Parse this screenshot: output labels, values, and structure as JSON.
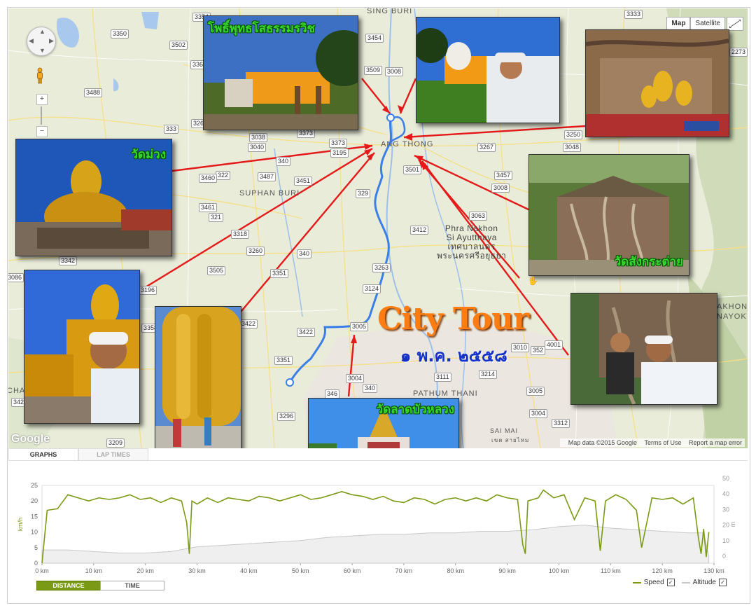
{
  "map": {
    "map_type_buttons": [
      {
        "label": "Map",
        "selected": true
      },
      {
        "label": "Satellite",
        "selected": false
      }
    ],
    "attribution": {
      "data": "Map data ©2015 Google",
      "terms": "Terms of Use",
      "report": "Report a map error"
    },
    "logo_text": "Google",
    "pan_icon": "pan-control-icon",
    "pegman_icon": "pegman-icon",
    "zoom_in": "+",
    "zoom_out": "−",
    "places": {
      "sing_buri": "SING BURI",
      "ang_thong": "ANG THONG",
      "suphan_buri": "SUPHAN BURI",
      "ayutthaya_1": "Phra Nakhon",
      "ayutthaya_2": "Si Ayutthaya",
      "ayutthaya_3": "เทศบาลนคร",
      "ayutthaya_4": "พระนครศรีอยุธยา",
      "pathum_thani": "PATHUM THANI",
      "sai_mai": "SAI MAI",
      "nakhon_nayok_1": "AKHON",
      "nakhon_nayok_2": "NAYOK",
      "cha": "CHA",
      "khet_sai_mai": "เขต สายไหม"
    },
    "road_numbers": [
      "3354",
      "3333",
      "3350",
      "3454",
      "3502",
      "3509",
      "3008",
      "2273",
      "3365",
      "3488",
      "3264",
      "3038",
      "3373",
      "3250",
      "333",
      "3040",
      "3373",
      "3195",
      "3267",
      "3048",
      "340",
      "322",
      "3487",
      "3451",
      "3501",
      "3460",
      "3457",
      "3008",
      "329",
      "3461",
      "321",
      "3063",
      "3318",
      "3412",
      "3260",
      "340",
      "3342",
      "3505",
      "3351",
      "3263",
      "3086",
      "3124",
      "3196",
      "3422",
      "3358",
      "3422",
      "3010",
      "352",
      "4001",
      "3351",
      "3005",
      "3004",
      "340",
      "3111",
      "3214",
      "346",
      "3429",
      "3296",
      "3005",
      "3004",
      "3312",
      "3209"
    ],
    "photo_captions": {
      "p1": "โพธิ์พุทธโสธรรมรวิช",
      "p3": "วัดม่วง",
      "p5": "วัดสังกระต่าย",
      "p7": "วัดลาดบัวหลวง"
    },
    "title": "City Tour",
    "subtitle": "๑ พ.ค. ๒๕๕๘"
  },
  "tabs": [
    {
      "label": "GRAPHS",
      "active": true
    },
    {
      "label": "LAP TIMES",
      "active": false
    }
  ],
  "graph": {
    "left_axis_label": "km/h",
    "right_axis_label": "m",
    "left_ticks": [
      "25",
      "20",
      "15",
      "10",
      "5",
      "0"
    ],
    "right_ticks": [
      "50",
      "40",
      "30",
      "20",
      "10",
      "0"
    ],
    "x_ticks": [
      "0 km",
      "10 km",
      "20 km",
      "30 km",
      "40 km",
      "50 km",
      "60 km",
      "70 km",
      "80 km",
      "90 km",
      "100 km",
      "110 km",
      "120 km",
      "130 km"
    ],
    "toggle": [
      {
        "label": "DISTANCE",
        "active": true
      },
      {
        "label": "TIME",
        "active": false
      }
    ],
    "legend": [
      {
        "name": "Speed",
        "checked": true
      },
      {
        "name": "Altitude",
        "checked": true
      }
    ],
    "colors": {
      "speed": "#7a9a14",
      "altitude": "#c8c8c8",
      "route": "#3a7ee8",
      "arrow": "#e41a1a"
    }
  },
  "chart_data": {
    "type": "line",
    "xlabel": "",
    "ylabel": "km/h",
    "y2label": "m",
    "xlim": [
      0,
      130
    ],
    "ylim": [
      0,
      25
    ],
    "y2lim": [
      0,
      50
    ],
    "series": [
      {
        "name": "Speed",
        "axis": "left",
        "x": [
          0,
          1,
          3,
          5,
          7,
          9,
          11,
          13,
          15,
          17,
          19,
          21,
          23,
          25,
          27,
          28,
          28.5,
          29,
          30,
          32,
          34,
          36,
          38,
          40,
          42,
          44,
          46,
          48,
          50,
          52,
          54,
          56,
          58,
          60,
          62,
          64,
          66,
          68,
          70,
          72,
          74,
          76,
          78,
          80,
          82,
          84,
          86,
          88,
          90,
          92,
          93,
          93.5,
          94,
          96,
          97,
          99,
          101,
          103,
          105,
          107,
          108,
          109,
          111,
          113,
          115,
          116,
          118,
          120,
          122,
          124,
          126,
          127,
          127.5,
          128,
          128.5,
          129
        ],
        "values": [
          0,
          17,
          17.5,
          22,
          21,
          20,
          21,
          20.5,
          21,
          22,
          20.5,
          21,
          19.5,
          21,
          20,
          13,
          3,
          20,
          19,
          21,
          19.5,
          21,
          20.5,
          20,
          21.5,
          21,
          20,
          21,
          22,
          20.5,
          21,
          22,
          23,
          22,
          21.5,
          20.5,
          21.5,
          20,
          19.5,
          21,
          20.5,
          19,
          20.5,
          21,
          20,
          21,
          20,
          22,
          21,
          20.5,
          6,
          3,
          20,
          21,
          23.5,
          21,
          22,
          14,
          21,
          20,
          4,
          20,
          22,
          20.5,
          17,
          5,
          21,
          20.5,
          21,
          19,
          21,
          8,
          3,
          11,
          2,
          10
        ]
      },
      {
        "name": "Altitude",
        "axis": "right",
        "x": [
          0,
          5,
          10,
          15,
          20,
          25,
          30,
          35,
          40,
          45,
          50,
          55,
          60,
          65,
          70,
          75,
          80,
          85,
          90,
          95,
          100,
          105,
          110,
          115,
          120,
          125,
          128,
          129
        ],
        "values": [
          4,
          4,
          3,
          2,
          2,
          3,
          6,
          7,
          8,
          9,
          10,
          12,
          13,
          14,
          14,
          15,
          15,
          16,
          16,
          17,
          19,
          20,
          18,
          17,
          16,
          15,
          15,
          0
        ]
      }
    ]
  }
}
